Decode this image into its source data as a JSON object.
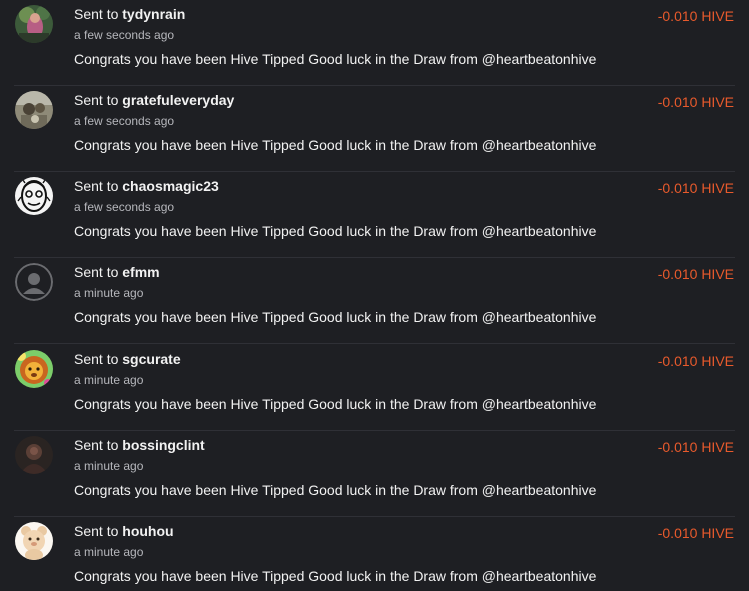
{
  "amount_color": "#e85a2c",
  "transactions": [
    {
      "prefix": "Sent to",
      "recipient": "tydynrain",
      "time": "a few seconds ago",
      "memo": "Congrats you have been Hive Tipped Good luck in the Draw from @heartbeatonhive",
      "amount": "-0.010 HIVE",
      "avatar_icon": "avatar-photo-icon"
    },
    {
      "prefix": "Sent to",
      "recipient": "gratefuleveryday",
      "time": "a few seconds ago",
      "memo": "Congrats you have been Hive Tipped Good luck in the Draw from @heartbeatonhive",
      "amount": "-0.010 HIVE",
      "avatar_icon": "avatar-photo-icon"
    },
    {
      "prefix": "Sent to",
      "recipient": "chaosmagic23",
      "time": "a few seconds ago",
      "memo": "Congrats you have been Hive Tipped Good luck in the Draw from @heartbeatonhive",
      "amount": "-0.010 HIVE",
      "avatar_icon": "avatar-sketch-icon"
    },
    {
      "prefix": "Sent to",
      "recipient": "efmm",
      "time": "a minute ago",
      "memo": "Congrats you have been Hive Tipped Good luck in the Draw from @heartbeatonhive",
      "amount": "-0.010 HIVE",
      "avatar_icon": "default-user-icon"
    },
    {
      "prefix": "Sent to",
      "recipient": "sgcurate",
      "time": "a minute ago",
      "memo": "Congrats you have been Hive Tipped Good luck in the Draw from @heartbeatonhive",
      "amount": "-0.010 HIVE",
      "avatar_icon": "lion-avatar-icon"
    },
    {
      "prefix": "Sent to",
      "recipient": "bossingclint",
      "time": "a minute ago",
      "memo": "Congrats you have been Hive Tipped Good luck in the Draw from @heartbeatonhive",
      "amount": "-0.010 HIVE",
      "avatar_icon": "avatar-photo-icon"
    },
    {
      "prefix": "Sent to",
      "recipient": "houhou",
      "time": "a minute ago",
      "memo": "Congrats you have been Hive Tipped Good luck in the Draw from @heartbeatonhive",
      "amount": "-0.010 HIVE",
      "avatar_icon": "bear-avatar-icon"
    }
  ]
}
